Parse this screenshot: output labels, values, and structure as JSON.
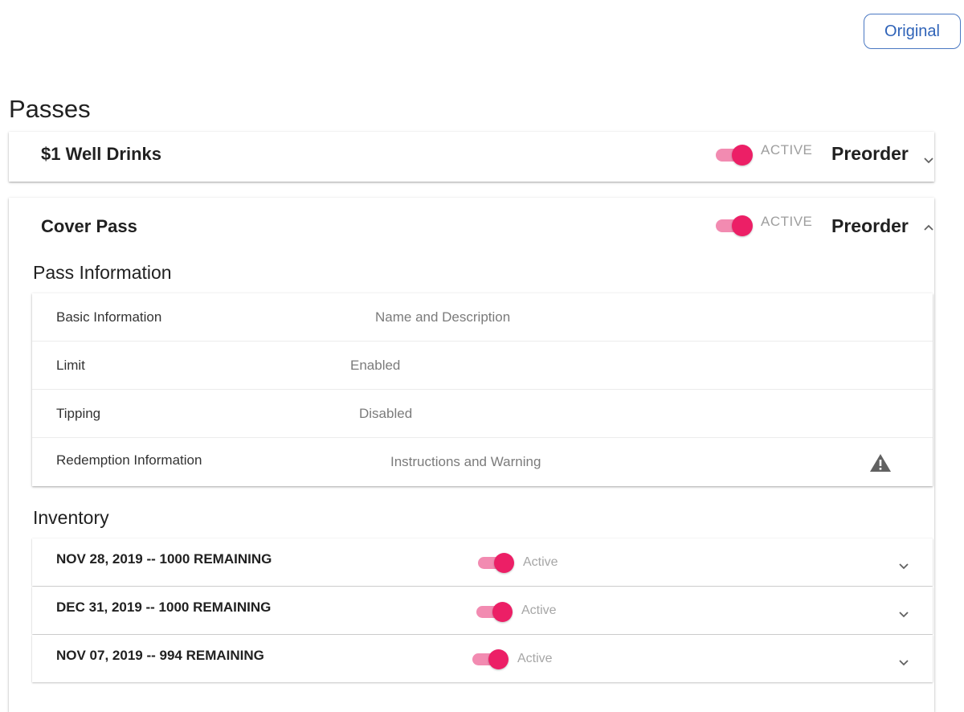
{
  "header": {
    "original_button": "Original"
  },
  "page_title": "Passes",
  "colors": {
    "accent": "#ec1f66",
    "accent_track": "#f28bb1",
    "link": "#2f63b8"
  },
  "passes": [
    {
      "name": "$1 Well Drinks",
      "status": "ACTIVE",
      "type": "Preorder",
      "enabled": true,
      "expanded": false
    },
    {
      "name": "Cover Pass",
      "status": "ACTIVE",
      "type": "Preorder",
      "enabled": true,
      "expanded": true,
      "pass_information": {
        "title": "Pass Information",
        "rows": [
          {
            "label": "Basic Information",
            "value": "Name and Description"
          },
          {
            "label": "Limit",
            "value": "Enabled"
          },
          {
            "label": "Tipping",
            "value": "Disabled"
          },
          {
            "label": "Redemption Information",
            "value": "Instructions and Warning",
            "icon": "warning-icon"
          }
        ]
      },
      "inventory": {
        "title": "Inventory",
        "rows": [
          {
            "label": "NOV 28, 2019 -- 1000 REMAINING",
            "status": "Active",
            "enabled": true
          },
          {
            "label": "DEC 31, 2019 -- 1000 REMAINING",
            "status": "Active",
            "enabled": true
          },
          {
            "label": "NOV 07, 2019 -- 994 REMAINING",
            "status": "Active",
            "enabled": true
          }
        ]
      }
    }
  ]
}
